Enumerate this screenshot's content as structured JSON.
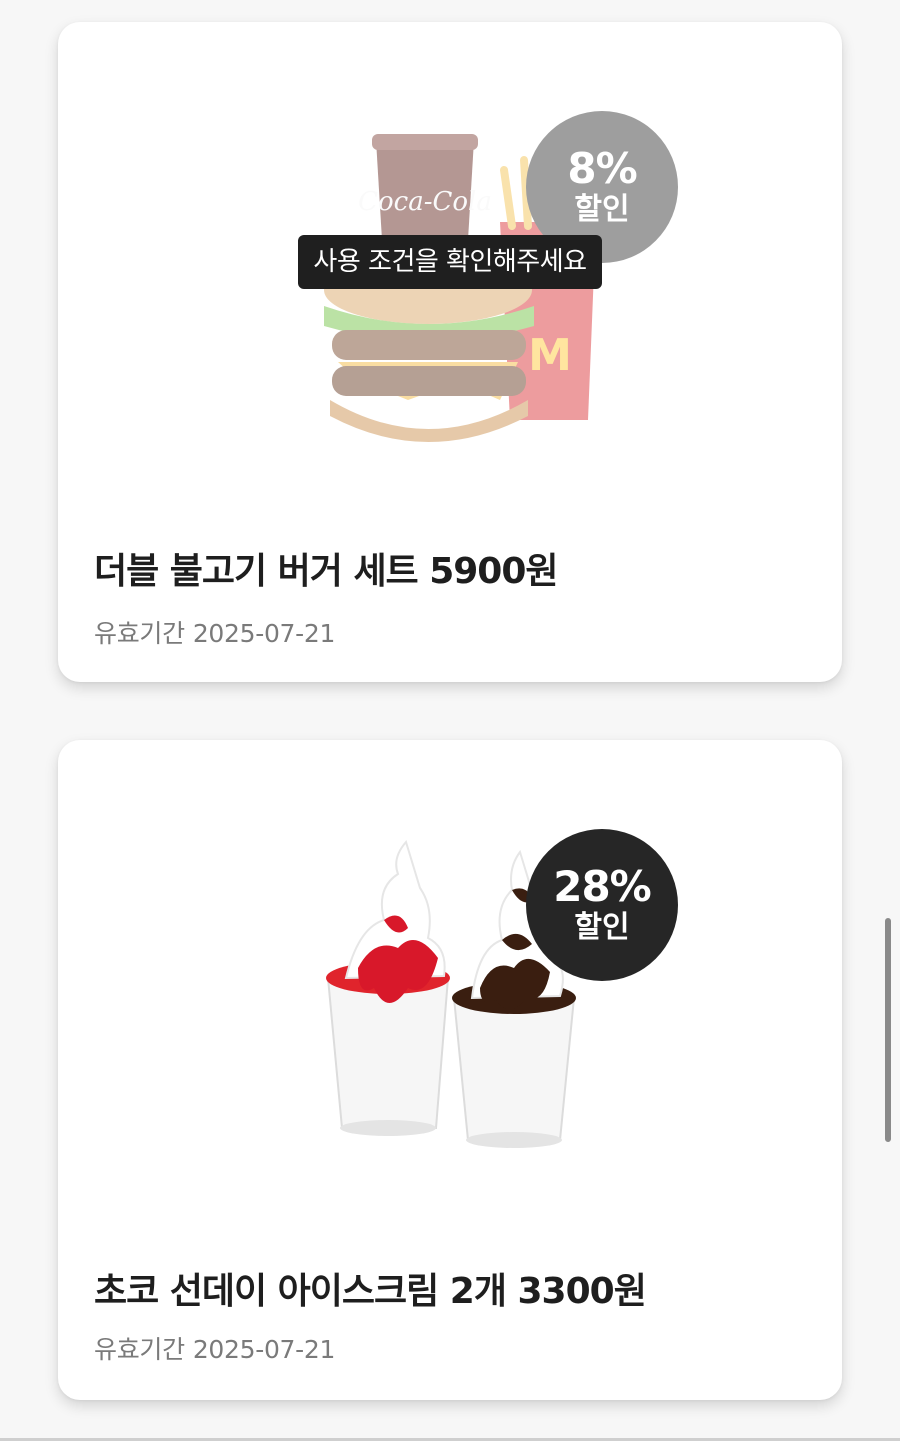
{
  "coupons": [
    {
      "discount_percent": "8%",
      "discount_label": "할인",
      "tooltip": "사용 조건을 확인해주세요",
      "title": "더블 불고기 버거 세트 5900원",
      "validity_label": "유효기간",
      "validity_date": "2025-07-21",
      "image_icon": "burger-set-image",
      "badge_color": "#9e9e9e",
      "disabled": true
    },
    {
      "discount_percent": "28%",
      "discount_label": "할인",
      "title": "초코 선데이 아이스크림 2개 3300원",
      "validity_label": "유효기간",
      "validity_date": "2025-07-21",
      "image_icon": "sundae-image",
      "badge_color": "#262626",
      "disabled": false
    }
  ]
}
